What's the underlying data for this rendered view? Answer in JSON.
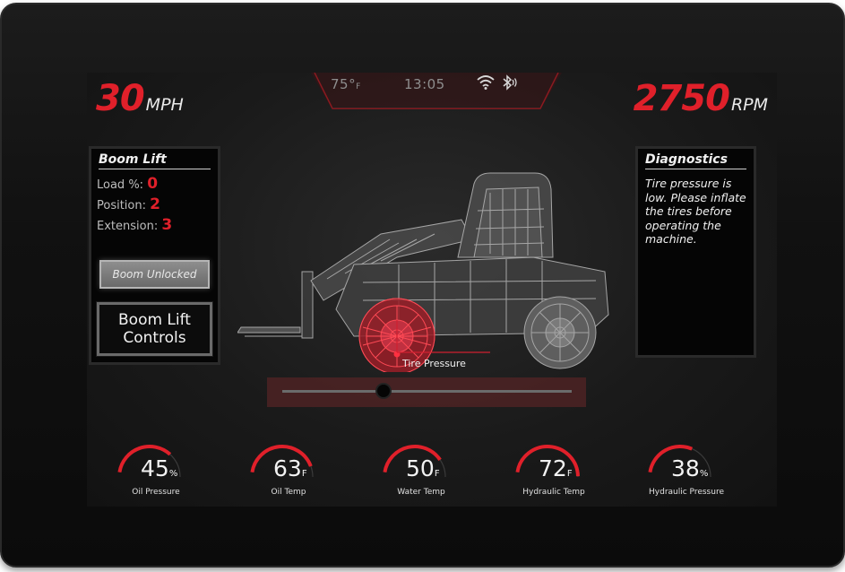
{
  "status": {
    "temperature": "75°",
    "temperature_unit": "F",
    "time": "13:05"
  },
  "speed": {
    "value": "30",
    "unit": "MPH"
  },
  "rpm": {
    "value": "2750",
    "unit": "RPM"
  },
  "boom_panel": {
    "title": "Boom Lift",
    "load_label": "Load %:",
    "load_value": "0",
    "position_label": "Position:",
    "position_value": "2",
    "extension_label": "Extension:",
    "extension_value": "3",
    "unlocked_button": "Boom Unlocked",
    "controls_button_line1": "Boom Lift",
    "controls_button_line2": "Controls"
  },
  "diagnostics": {
    "title": "Diagnostics",
    "message": "Tire pressure is low. Please inflate the tires before operating the machine."
  },
  "callout": {
    "label": "Tire Pressure"
  },
  "slider": {
    "position_fraction": 0.35
  },
  "gauges": [
    {
      "value": "45",
      "unit": "%",
      "label": "Oil Pressure",
      "fraction": 0.45
    },
    {
      "value": "63",
      "unit": "F",
      "label": "Oil Temp",
      "fraction": 0.55
    },
    {
      "value": "50",
      "unit": "F",
      "label": "Water Temp",
      "fraction": 0.5
    },
    {
      "value": "72",
      "unit": "F",
      "label": "Hydraulic Temp",
      "fraction": 0.62
    },
    {
      "value": "38",
      "unit": "%",
      "label": "Hydraulic Pressure",
      "fraction": 0.38
    }
  ],
  "icons": [
    "wifi-icon",
    "bluetooth-icon"
  ],
  "colors": {
    "accent": "#e0202a",
    "panel_bg": "#050505",
    "screen_bg": "#1a1a1a"
  }
}
